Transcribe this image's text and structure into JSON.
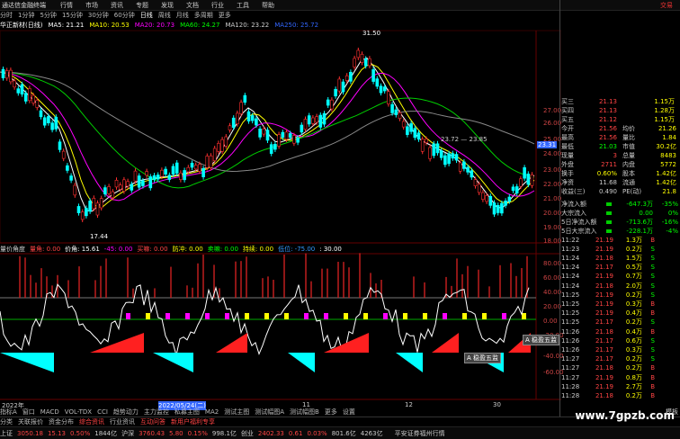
{
  "app": {
    "logo": "通达信金融终端",
    "menu": [
      "行情",
      "市场",
      "资讯",
      "专题",
      "发现",
      "文档",
      "行业",
      "工具",
      "帮助"
    ],
    "right_label": "交易"
  },
  "periods": [
    "分时",
    "1分钟",
    "5分钟",
    "15分钟",
    "30分钟",
    "60分钟",
    "日线",
    "周线",
    "月线",
    "多周期",
    "更多"
  ],
  "stock": {
    "name": "华正新材(日线)",
    "ma": [
      {
        "label": "MA5: 21.21",
        "color": "#ffffff"
      },
      {
        "label": "MA10: 20.53",
        "color": "#ffff00"
      },
      {
        "label": "MA20: 20.73",
        "color": "#ff00ff"
      },
      {
        "label": "MA60: 24.27",
        "color": "#00ff00"
      },
      {
        "label": "MA120: 23.22",
        "color": "#cccccc"
      },
      {
        "label": "MA250: 25.72",
        "color": "#3366ff"
      }
    ],
    "high_label": "31.50",
    "low_label": "17.44",
    "range_label": "23.72 — 23.85",
    "price_tag": "23.31"
  },
  "price_axis": [
    "27.00",
    "26.00",
    "25.00",
    "24.00",
    "23.00",
    "22.00",
    "21.00",
    "20.00",
    "19.00",
    "18.00"
  ],
  "indicator": {
    "name": "量价角度",
    "items": [
      {
        "label": "量角: 0.00",
        "color": "#ff4444"
      },
      {
        "label": "价角: 15.61",
        "color": "#ffffff"
      },
      {
        "label": "-45: 0.00",
        "color": "#ff00ff"
      },
      {
        "label": "买嘛: 0.00",
        "color": "#ff4444"
      },
      {
        "label": "防冲: 0.00",
        "color": "#ffff00"
      },
      {
        "label": "卖嘛: 0.00",
        "color": "#00ff00"
      },
      {
        "label": "持续: 0.00",
        "color": "#ffff00"
      },
      {
        "label": "低位: -75.00",
        "color": "#3399ff"
      },
      {
        "label": ": 30.00",
        "color": "#ffffff"
      }
    ],
    "axis": [
      "80.00",
      "60.00",
      "40.00",
      "20.00",
      "0.00",
      "-20.00",
      "-40.00",
      "-60.00"
    ]
  },
  "quote": {
    "rows": [
      {
        "l": "买三",
        "v": "21.13",
        "q": "1.15万",
        "c": "#ff4444"
      },
      {
        "l": "买四",
        "v": "21.13",
        "q": "1.28万",
        "c": "#ff4444"
      },
      {
        "l": "买五",
        "v": "21.12",
        "q": "1.15万",
        "c": "#ff4444"
      },
      {
        "l": "今开",
        "v": "21.56",
        "k": "均价",
        "kv": "21.26",
        "c": "#ff4444"
      },
      {
        "l": "最高",
        "v": "21.56",
        "k": "量比",
        "kv": "1.84",
        "c": "#ff4444"
      },
      {
        "l": "最低",
        "v": "21.03",
        "k": "市值",
        "kv": "30.2亿",
        "c": "#00ff00"
      },
      {
        "l": "现量",
        "v": "3",
        "k": "总量",
        "kv": "8483",
        "c": "#ff4444"
      },
      {
        "l": "外盘",
        "v": "2711",
        "k": "内盘",
        "kv": "5772",
        "c": "#ff4444"
      },
      {
        "l": "换手",
        "v": "0.60%",
        "k": "股本",
        "kv": "1.42亿",
        "c": "#ffff00"
      },
      {
        "l": "净资",
        "v": "11.68",
        "k": "流通",
        "kv": "1.42亿",
        "c": "#cccccc"
      },
      {
        "l": "收益(三)",
        "v": "0.490",
        "k": "PE(动)",
        "kv": "21.8",
        "c": "#cccccc"
      }
    ],
    "flows": [
      {
        "l": "净流入额",
        "v": "-647.3万",
        "p": "-35%"
      },
      {
        "l": "大宗流入",
        "v": "0.00",
        "p": "0%"
      },
      {
        "l": "5日净流入额",
        "v": "-713.6万",
        "p": "-16%"
      },
      {
        "l": "5日大宗流入",
        "v": "-228.1万",
        "p": "-4%"
      }
    ]
  },
  "ticks": [
    {
      "t": "11:22",
      "p": "21.19",
      "v": "1.3万",
      "s": "B"
    },
    {
      "t": "11:23",
      "p": "21.19",
      "v": "0.2万",
      "s": "S"
    },
    {
      "t": "11:24",
      "p": "21.18",
      "v": "1.5万",
      "s": "S"
    },
    {
      "t": "11:24",
      "p": "21.17",
      "v": "0.5万",
      "s": "S"
    },
    {
      "t": "11:24",
      "p": "21.19",
      "v": "0.7万",
      "s": "S"
    },
    {
      "t": "11:24",
      "p": "21.18",
      "v": "2.0万",
      "s": "S"
    },
    {
      "t": "11:25",
      "p": "21.19",
      "v": "0.2万",
      "s": "S"
    },
    {
      "t": "11:25",
      "p": "21.19",
      "v": "0.3万",
      "s": "B"
    },
    {
      "t": "11:25",
      "p": "21.19",
      "v": "0.4万",
      "s": "B"
    },
    {
      "t": "11:25",
      "p": "21.17",
      "v": "0.2万",
      "s": "S"
    },
    {
      "t": "11:26",
      "p": "21.18",
      "v": "0.4万",
      "s": "B"
    },
    {
      "t": "11:26",
      "p": "21.17",
      "v": "0.6万",
      "s": "S"
    },
    {
      "t": "11:26",
      "p": "21.17",
      "v": "0.3万",
      "s": "S"
    },
    {
      "t": "11:27",
      "p": "21.17",
      "v": "0.2万",
      "s": "S"
    },
    {
      "t": "11:27",
      "p": "21.18",
      "v": "0.2万",
      "s": "B"
    },
    {
      "t": "11:27",
      "p": "21.19",
      "v": "0.8万",
      "s": "B"
    },
    {
      "t": "11:28",
      "p": "21.19",
      "v": "2.7万",
      "s": "B"
    },
    {
      "t": "11:28",
      "p": "21.18",
      "v": "0.2万",
      "s": "B"
    }
  ],
  "popups": [
    "A 稳盈五监",
    "A 稳盈五监"
  ],
  "dates": [
    "2022年",
    "2022/05/24(二)",
    "11",
    "12",
    "30"
  ],
  "funcbar": [
    "指标A",
    "窗口",
    "MACD",
    "VOL-TDX",
    "CCI",
    "趋势动力",
    "主力监控",
    "私募主图",
    "MA2",
    "测试主图",
    "测试幅图A",
    "测试幅图B",
    "更多",
    "设置"
  ],
  "bottomtabs": [
    "分类",
    "关联报价",
    "资金分布",
    "综合资讯",
    "行业资讯",
    "互动问答",
    "新用户福利专享"
  ],
  "status": [
    {
      "label": "上证",
      "value": "3050.18",
      "c1": "15.13",
      "c2": "0.50%",
      "amt": "1844亿"
    },
    {
      "label": "沪深",
      "value": "3760.43",
      "c1": "5.80",
      "c2": "0.15%",
      "amt": "998.1亿"
    },
    {
      "label": "创业",
      "value": "2402.33",
      "c1": "0.61",
      "c2": "0.03%",
      "amt": "801.6亿"
    }
  ],
  "status_tail": "4263亿",
  "status_right": "平安证券福州行情",
  "right_mini": "模板",
  "watermark": "www.7gpzb.com"
}
